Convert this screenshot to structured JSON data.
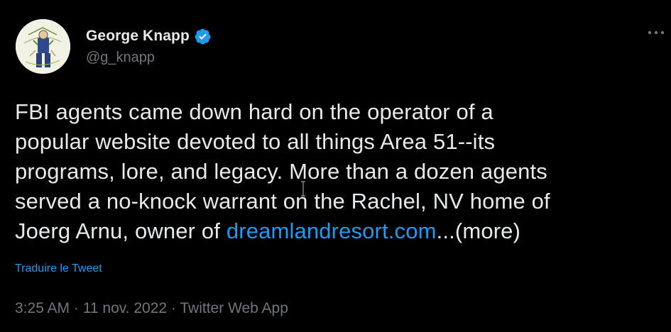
{
  "author": {
    "display_name": "George Knapp",
    "handle": "@g_knapp",
    "verified": true
  },
  "tweet": {
    "text_lines": [
      "FBI agents came down hard on the operator of a",
      "popular website devoted to all things Area 51--its",
      "programs, lore, and legacy. More than a dozen agents",
      "served a no-knock warrant on the Rachel, NV home of",
      "Joerg Arnu, owner of "
    ],
    "link_text": "dreamlandresort.com",
    "more_text": "...(more)",
    "translate_label": "Traduire le Tweet"
  },
  "meta": {
    "time": "3:25 AM",
    "separator": "·",
    "date": "11 nov. 2022",
    "source": "Twitter Web App"
  },
  "icons": {
    "verified": "verified-badge-icon",
    "more": "more-dots-icon"
  },
  "colors": {
    "background": "#000000",
    "primary_text": "#e7e9ea",
    "secondary_text": "#71767b",
    "link": "#1d9bf0"
  }
}
